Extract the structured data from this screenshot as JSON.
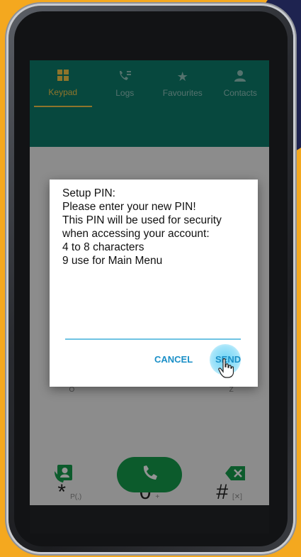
{
  "colors": {
    "background": "#f4a81f",
    "topbar": "#0d7c6c",
    "accent_tab": "#f4c94a",
    "dialog_button": "#1a8fc7",
    "call_button": "#169e4c"
  },
  "tabs": [
    {
      "label": "Keypad",
      "icon": "keypad-icon",
      "active": true
    },
    {
      "label": "Logs",
      "icon": "logs-icon",
      "active": false
    },
    {
      "label": "Favourites",
      "icon": "star-icon",
      "active": false
    },
    {
      "label": "Contacts",
      "icon": "contacts-icon",
      "active": false
    }
  ],
  "dialog": {
    "lines": [
      "Setup PIN:",
      "Please enter your new PIN!",
      "This PIN will be used for security",
      "when accessing your account:",
      "4 to 8 characters",
      "9 use for Main Menu"
    ],
    "input_value": "",
    "cancel_label": "CANCEL",
    "send_label": "SEND"
  },
  "keypad": {
    "row_partial": [
      {
        "main": "",
        "sub": "O"
      },
      {
        "main": "",
        "sub": "Z"
      }
    ],
    "bottom_row": [
      {
        "main": "*",
        "sub": "P(,)"
      },
      {
        "main": "0",
        "sub": "+"
      },
      {
        "main": "#",
        "sub": "[✕]"
      }
    ]
  },
  "actions": {
    "contact_icon": "contact-card-icon",
    "call_icon": "phone-icon",
    "delete_icon": "backspace-icon"
  }
}
